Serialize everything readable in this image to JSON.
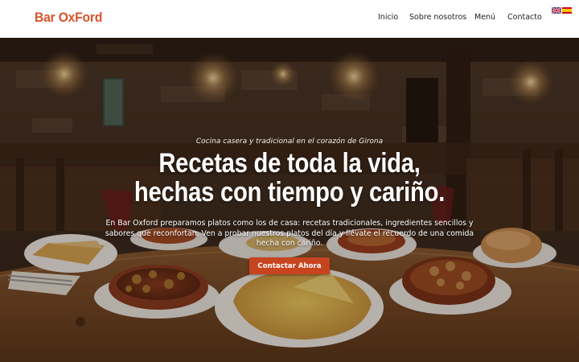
{
  "header": {
    "logo": "Bar OxFord",
    "nav": [
      {
        "label": "Inicio"
      },
      {
        "label": "Sobre nosotros"
      },
      {
        "label": "Menú"
      },
      {
        "label": "Contacto"
      }
    ],
    "languages": [
      "english-flag-icon",
      "spanish-flag-icon"
    ]
  },
  "hero": {
    "tagline": "Cocina casera y tradicional en el corazón de Girona",
    "headline_line1": "Recetas de toda la vida,",
    "headline_line2": "hechas con tiempo y cariño.",
    "intro": "En Bar Oxford preparamos platos como los de casa: recetas tradicionales, ingredientes sencillos y sabores que reconfortan. Ven a probar nuestros platos del día y llévate el recuerdo de una comida hecha con cariño.",
    "cta_label": "Contactar Ahora"
  },
  "colors": {
    "brand": "#d9532b",
    "cta": "#c8441f"
  }
}
